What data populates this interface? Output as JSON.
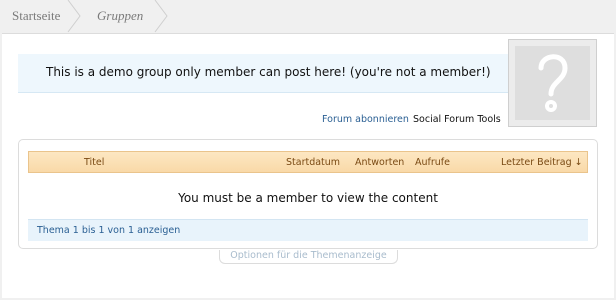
{
  "breadcrumb": {
    "items": [
      "Startseite",
      "Gruppen"
    ]
  },
  "group": {
    "header": "This is a demo group only member can post here! (you're not a member!)"
  },
  "tools": {
    "subscribe": "Forum abonnieren",
    "social": "Social Forum Tools"
  },
  "table": {
    "columns": [
      "Titel",
      "Startdatum",
      "Antworten",
      "Aufrufe",
      "Letzter Beitrag ↓"
    ],
    "empty_message": "You must be a member to view the content",
    "footer": "Thema 1 bis 1 von 1 anzeigen"
  },
  "options": {
    "label": "Optionen für die Themenanzeige"
  },
  "colors": {
    "header_bg": "#eef7fd",
    "table_head_bg": "#f9d9a8",
    "link": "#2a5f93"
  }
}
